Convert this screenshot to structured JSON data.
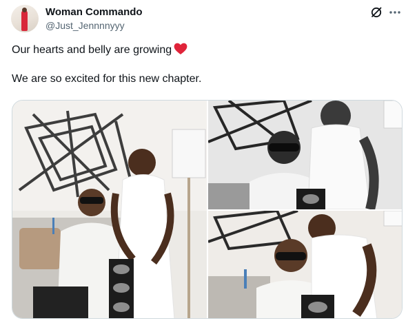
{
  "tweet": {
    "author": {
      "display_name": "Woman Commando",
      "handle": "@Just_Jennnnyyy"
    },
    "text_line_1": "Our hearts and belly are growing",
    "text_line_2": "We are so excited for this new chapter.",
    "emoji": "red-heart",
    "actions": {
      "grok_icon": "grok-slash-circle-icon",
      "more_icon": "more-horizontal-icon"
    },
    "media": [
      {
        "description_icon": "photo",
        "tone": "color"
      },
      {
        "description_icon": "photo",
        "tone": "grayscale"
      },
      {
        "description_icon": "photo",
        "tone": "color"
      }
    ]
  },
  "colors": {
    "text_primary": "#0f1419",
    "text_secondary": "#536471",
    "heart": "#f91880",
    "border": "#cfd9de"
  }
}
